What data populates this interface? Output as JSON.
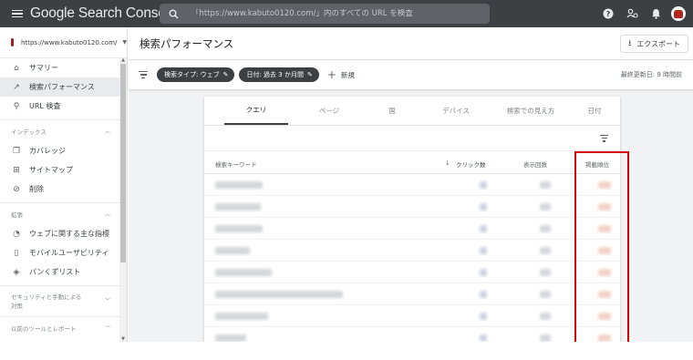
{
  "topbar": {
    "title": "Google Search Console",
    "search_placeholder": "「https://www.kabuto0120.com/」内のすべての URL を検査",
    "help_icon": "help-icon",
    "settings_icon": "manage-users-icon",
    "notifications_icon": "bell-icon"
  },
  "sidebar": {
    "property": "https://www.kabuto0120.com/",
    "items_main": [
      {
        "label": "サマリー",
        "icon": "home-icon"
      },
      {
        "label": "検索パフォーマンス",
        "icon": "trending-icon"
      },
      {
        "label": "URL 検査",
        "icon": "search-icon"
      }
    ],
    "section_index": "インデックス",
    "items_index": [
      {
        "label": "カバレッジ",
        "icon": "coverage-icon"
      },
      {
        "label": "サイトマップ",
        "icon": "sitemap-icon"
      },
      {
        "label": "削除",
        "icon": "removal-icon"
      }
    ],
    "section_enhance": "拡張",
    "items_enhance": [
      {
        "label": "ウェブに関する主な指標",
        "icon": "speed-icon"
      },
      {
        "label": "モバイルユーザビリティ",
        "icon": "mobile-icon"
      },
      {
        "label": "パンくずリスト",
        "icon": "breadcrumb-icon"
      }
    ],
    "section_security_line1": "セキュリティと手動による",
    "section_security_line2": "対策",
    "section_legacy": "以前のツールとレポート"
  },
  "main": {
    "title": "検索パフォーマンス",
    "export_label": "エクスポート",
    "chips": [
      {
        "label": "検索タイプ: ウェブ"
      },
      {
        "label": "日付: 過去 3 か月間"
      }
    ],
    "new_label": "新規",
    "updated": "最終更新日: 9 時間前"
  },
  "card": {
    "tabs": [
      "クエリ",
      "ページ",
      "国",
      "デバイス",
      "検索での見え方",
      "日付"
    ],
    "columns": {
      "keyword": "検索キーワード",
      "clicks": "クリック数",
      "impressions": "表示回数",
      "position": "掲載順位"
    },
    "row_count": 8
  },
  "colors": {
    "topbar": "#3c4043",
    "highlight": "#d50000"
  }
}
